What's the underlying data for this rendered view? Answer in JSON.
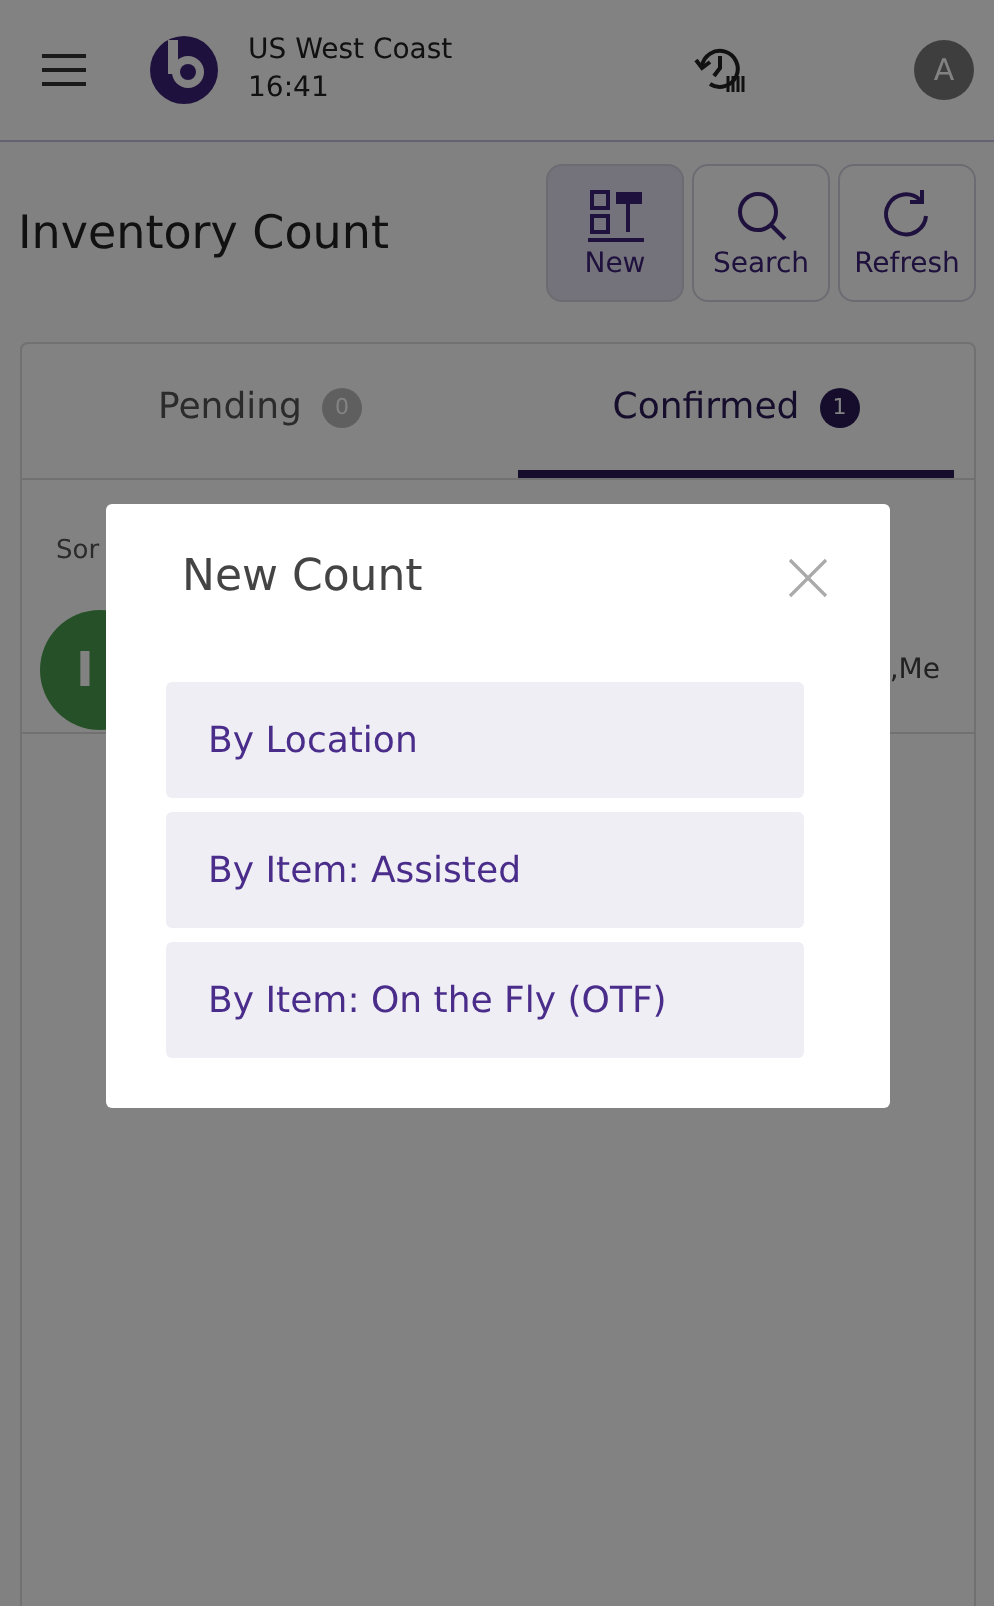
{
  "header": {
    "location": "US West Coast",
    "time": "16:41",
    "avatar": "A"
  },
  "page": {
    "title": "Inventory Count",
    "actions": [
      {
        "label": "New",
        "selected": true
      },
      {
        "label": "Search",
        "selected": false
      },
      {
        "label": "Refresh",
        "selected": false
      }
    ]
  },
  "tabs": [
    {
      "label": "Pending",
      "count": "0",
      "selected": false
    },
    {
      "label": "Confirmed",
      "count": "1",
      "selected": true
    }
  ],
  "list": {
    "sort_label": "Sor",
    "rows": [
      {
        "avatar": "I",
        "trailing": ",Me"
      }
    ]
  },
  "modal": {
    "title": "New Count",
    "options": [
      "By Location",
      "By Item: Assisted",
      "By Item: On the Fly (OTF)"
    ]
  }
}
